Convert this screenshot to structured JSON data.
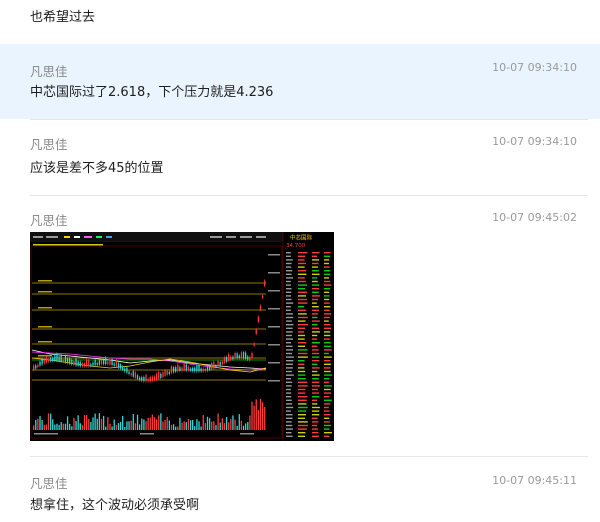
{
  "top_message": {
    "text": "也希望过去"
  },
  "messages": [
    {
      "author": "凡思佳",
      "time": "10-07 09:34:10",
      "text": "中芯国际过了2.618，下个压力就是4.236"
    },
    {
      "author": "凡思佳",
      "time": "10-07 09:34:10",
      "text": "应该是差不多45的位置"
    },
    {
      "author": "凡思佳",
      "time": "10-07 09:45:02",
      "image": {
        "kind": "stock-chart-screenshot",
        "stock_name": "中芯国际",
        "last_price": "34.700"
      }
    },
    {
      "author": "凡思佳",
      "time": "10-07 09:45:11",
      "text": "想拿住，这个波动必须承受啊"
    }
  ],
  "colors": {
    "highlight_bg": "#e9f4fe",
    "author": "#8a8a8a",
    "time": "#9a9a9a",
    "chart_bg": "#000000",
    "candle_up": "#ff3b3b",
    "candle_down": "#33d6d6",
    "fib_line": "#c9b400"
  }
}
